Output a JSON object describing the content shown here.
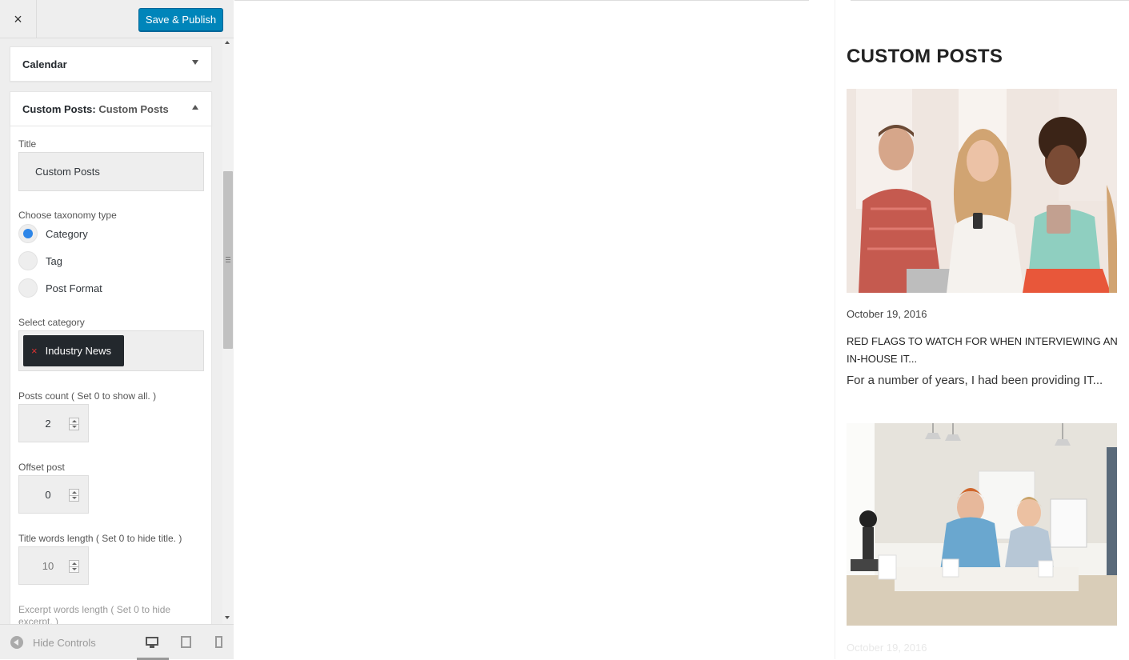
{
  "topbar": {
    "close_icon": "×",
    "publish_label": "Save & Publish",
    "publish_color": "#0085ba"
  },
  "widgets": {
    "calendar": {
      "title": "Calendar"
    },
    "custom_posts": {
      "title": "Custom Posts:",
      "subtitle": "Custom Posts"
    }
  },
  "form": {
    "title_label": "Title",
    "title_value": "Custom Posts",
    "taxonomy_label": "Choose taxonomy type",
    "taxonomy_options": [
      {
        "label": "Category",
        "checked": true
      },
      {
        "label": "Tag",
        "checked": false
      },
      {
        "label": "Post Format",
        "checked": false
      }
    ],
    "category_label": "Select category",
    "category_remove_icon": "×",
    "category_value": "Industry News",
    "posts_count_label": "Posts count ( Set 0 to show all. )",
    "posts_count_value": "2",
    "offset_label": "Offset post",
    "offset_value": "0",
    "title_words_label": "Title words length ( Set 0 to hide title. )",
    "title_words_value": "10",
    "excerpt_words_label": "Excerpt words length ( Set 0 to hide excerpt. )"
  },
  "footer": {
    "hide_controls_label": "Hide Controls"
  },
  "preview": {
    "heading": "CUSTOM POSTS",
    "posts": [
      {
        "date": "October 19, 2016",
        "title": "RED FLAGS TO WATCH FOR WHEN INTERVIEWING AN IN-HOUSE IT...",
        "excerpt": "For a number of years, I had been providing IT..."
      },
      {
        "date": "October 19, 2016"
      }
    ]
  }
}
